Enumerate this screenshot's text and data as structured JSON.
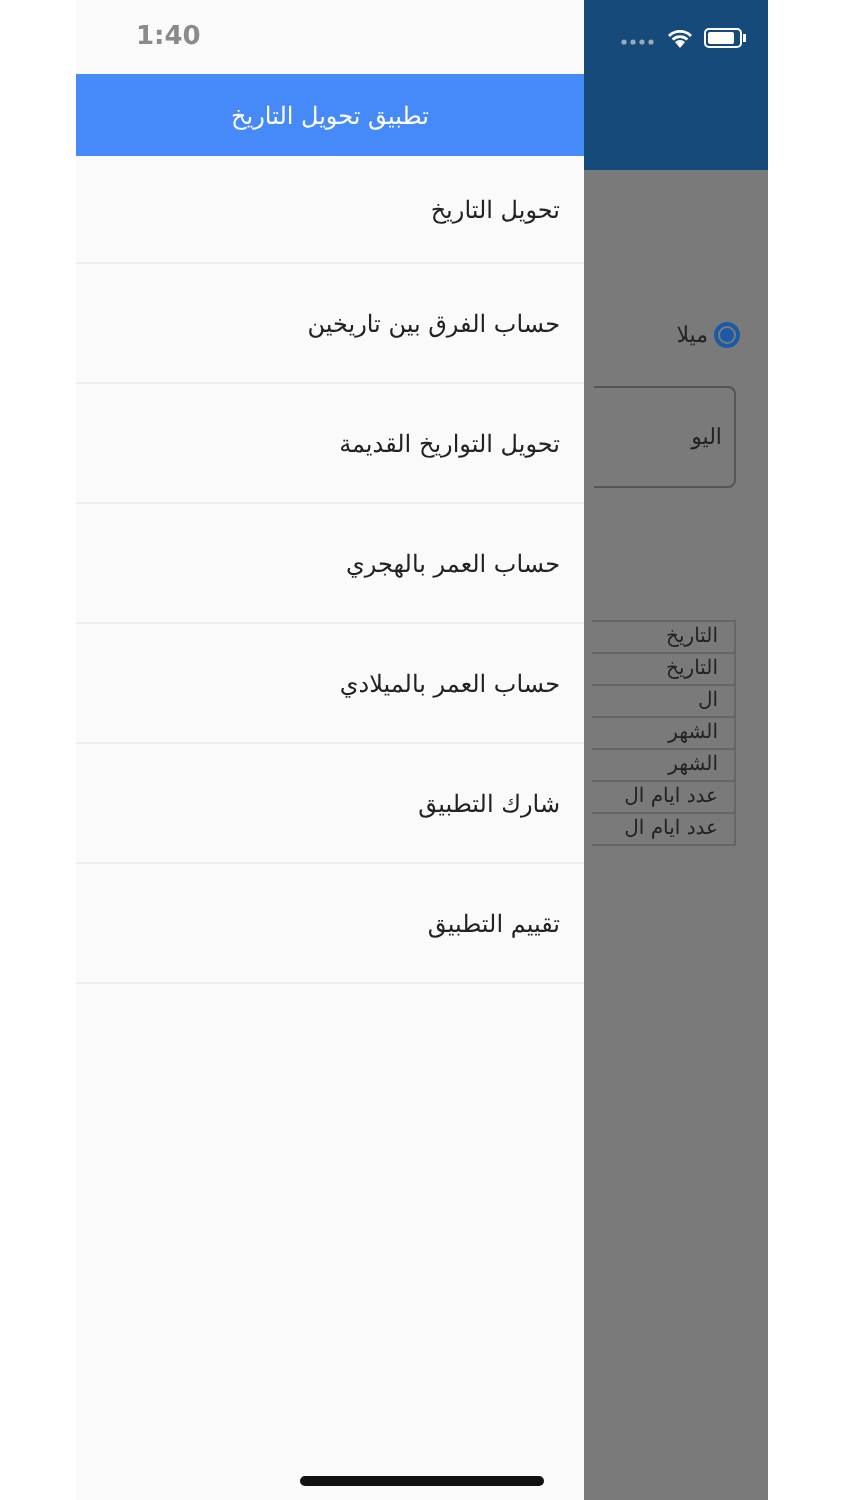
{
  "status_bar": {
    "time": "1:40"
  },
  "drawer": {
    "title": "تطبيق تحويل التاريخ",
    "items": [
      {
        "label": "تحويل التاريخ"
      },
      {
        "label": "حساب الفرق بين تاريخين"
      },
      {
        "label": "تحويل التواريخ القديمة"
      },
      {
        "label": "حساب العمر بالهجري"
      },
      {
        "label": "حساب العمر بالميلادي"
      },
      {
        "label": "شارك التطبيق"
      },
      {
        "label": "تقييم التطبيق"
      }
    ]
  },
  "background": {
    "radio": {
      "label": "ميلا",
      "selected": true
    },
    "field": {
      "value": "اليو"
    },
    "table_rows": [
      "التاريخ",
      "التاريخ",
      "ال",
      "الشهر",
      "الشهر",
      "عدد ايام ال",
      "عدد ايام ال"
    ]
  }
}
